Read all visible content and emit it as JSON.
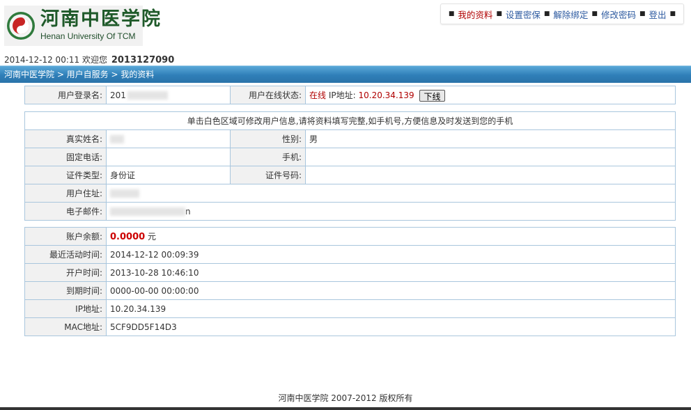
{
  "header": {
    "logo_cn": "河南中医学院",
    "logo_en": "Henan University Of TCM",
    "nav": [
      {
        "label": "我的资料",
        "active": true
      },
      {
        "label": "设置密保",
        "active": false
      },
      {
        "label": "解除绑定",
        "active": false
      },
      {
        "label": "修改密码",
        "active": false
      },
      {
        "label": "登出",
        "active": false
      }
    ]
  },
  "welcome": {
    "datetime": "2014-12-12 00:11",
    "greeting": "欢迎您",
    "user_id": "2013127090"
  },
  "breadcrumb": "河南中医学院 > 用户自服务 > 我的资料",
  "login_table": {
    "login_name_label": "用户登录名:",
    "login_name_value": "201",
    "online_status_label": "用户在线状态:",
    "online_status_value": "在线",
    "ip_label": "IP地址:",
    "ip_value": "10.20.34.139",
    "offline_button": "下线"
  },
  "profile_table": {
    "notice": "单击白色区域可修改用户信息,请将资料填写完整,如手机号,方便信息及时发送到您的手机",
    "real_name_label": "真实姓名:",
    "gender_label": "性别:",
    "gender_value": "男",
    "phone_label": "固定电话:",
    "phone_value": "",
    "mobile_label": "手机:",
    "mobile_value": "",
    "id_type_label": "证件类型:",
    "id_type_value": "身份证",
    "id_number_label": "证件号码:",
    "id_number_value": "",
    "address_label": "用户住址:",
    "email_label": "电子邮件:",
    "email_suffix": "n"
  },
  "account_table": {
    "balance_label": "账户余额:",
    "balance_value": "0.0000",
    "balance_unit": "元",
    "last_active_label": "最近活动时间:",
    "last_active_value": "2014-12-12 00:09:39",
    "open_time_label": "开户时间:",
    "open_time_value": "2013-10-28 10:46:10",
    "expire_label": "到期时间:",
    "expire_value": "0000-00-00 00:00:00",
    "ip_label": "IP地址:",
    "ip_value": "10.20.34.139",
    "mac_label": "MAC地址:",
    "mac_value": "5CF9DD5F14D3"
  },
  "footer": "河南中医学院 2007-2012 版权所有"
}
